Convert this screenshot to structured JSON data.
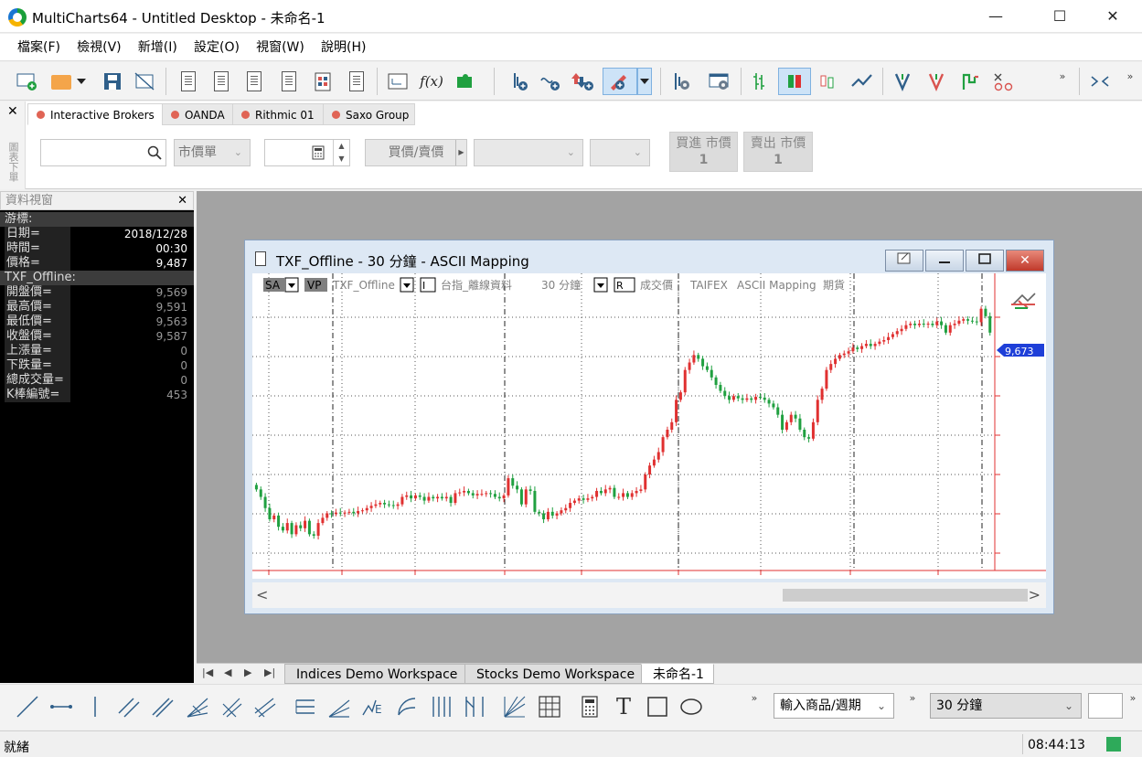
{
  "window": {
    "title": "MultiCharts64 - Untitled Desktop - 未命名-1",
    "minimize": "—",
    "maximize": "☐",
    "close": "✕"
  },
  "menu": [
    "檔案(F)",
    "檢視(V)",
    "新增(I)",
    "設定(O)",
    "視窗(W)",
    "說明(H)"
  ],
  "toolbar_icons": [
    "new-desktop-icon",
    "open-workspace-icon",
    "save-icon",
    "close-workspace-icon",
    "new-chart-icon",
    "new-scanner-icon",
    "new-dom-icon",
    "new-portfolio-icon",
    "new-spreadsheet-icon",
    "new-window-icon",
    "power-language-editor-icon",
    "add-component-icon",
    "insert-indicator-icon",
    "insert-signal-icon",
    "order-entry-icon",
    "draw-tool-icon",
    "format-icon",
    "chart-settings-icon",
    "ohlc-bar-icon",
    "candlestick-icon",
    "hollow-candle-icon",
    "line-chart-icon",
    "dot-icon",
    "v-icon",
    "step-icon",
    "x-o-icon",
    "collapse-icon"
  ],
  "order_panel": {
    "close": "✕",
    "side_label": "圖表下單",
    "brokers": [
      {
        "name": "Interactive Brokers",
        "active": true
      },
      {
        "name": "OANDA",
        "active": false
      },
      {
        "name": "Rithmic 01",
        "active": false
      },
      {
        "name": "Saxo Group",
        "active": false
      }
    ],
    "symbol_placeholder": "",
    "order_type": "市價單",
    "quantity": "",
    "buy_sell": "買價/賣價",
    "buy_button": {
      "label": "買進 市價",
      "qty": "1"
    },
    "sell_button": {
      "label": "賣出 市價",
      "qty": "1"
    }
  },
  "data_window": {
    "title": "資料視窗",
    "close": "✕",
    "cursor_section": "游標:",
    "cursor_rows": [
      {
        "label": "日期=",
        "value": "2018/12/28"
      },
      {
        "label": "時間=",
        "value": "00:30"
      },
      {
        "label": "價格=",
        "value": "9,487"
      }
    ],
    "symbol_section": "TXF_Offline:",
    "symbol_rows": [
      {
        "label": "開盤價=",
        "value": "9,569"
      },
      {
        "label": "最高價=",
        "value": "9,591"
      },
      {
        "label": "最低價=",
        "value": "9,563"
      },
      {
        "label": "收盤價=",
        "value": "9,587"
      },
      {
        "label": "上漲量=",
        "value": "0"
      },
      {
        "label": "下跌量=",
        "value": "0"
      },
      {
        "label": "總成交量=",
        "value": "0"
      },
      {
        "label": "K棒編號=",
        "value": "453"
      }
    ]
  },
  "chart_window": {
    "title": "TXF_Offline - 30 分鐘 - ASCII Mapping",
    "header": {
      "sa": "SA",
      "vp": "VP",
      "symbol": "TXF_Offline",
      "i_toggle": "I",
      "description": "台指_離線資料",
      "interval": "30 分鐘",
      "r_toggle": "R",
      "field": "成交價",
      "exchange": "TAIFEX",
      "data_source": "ASCII Mapping",
      "category": "期貨"
    },
    "last_price": "9,673",
    "scroll_left": "<",
    "scroll_right": ">"
  },
  "chart_data": {
    "type": "candlestick",
    "title": "TXF_Offline - 30 分鐘 - ASCII Mapping",
    "last_price": 9673,
    "up_color": "#e03030",
    "down_color": "#20a040",
    "closes": [
      9480,
      9470,
      9455,
      9440,
      9445,
      9430,
      9425,
      9435,
      9420,
      9432,
      9428,
      9438,
      9420,
      9418,
      9435,
      9442,
      9448,
      9447,
      9449,
      9448,
      9449,
      9450,
      9448,
      9451,
      9452,
      9455,
      9458,
      9460,
      9462,
      9460,
      9459,
      9458,
      9460,
      9470,
      9472,
      9468,
      9472,
      9470,
      9465,
      9470,
      9468,
      9470,
      9468,
      9470,
      9462,
      9475,
      9476,
      9478,
      9475,
      9472,
      9474,
      9474,
      9475,
      9474,
      9470,
      9468,
      9472,
      9495,
      9485,
      9480,
      9460,
      9480,
      9478,
      9450,
      9448,
      9440,
      9450,
      9445,
      9448,
      9452,
      9455,
      9462,
      9465,
      9468,
      9466,
      9468,
      9470,
      9478,
      9475,
      9480,
      9482,
      9470,
      9470,
      9475,
      9470,
      9475,
      9478,
      9480,
      9500,
      9512,
      9520,
      9530,
      9550,
      9560,
      9570,
      9600,
      9610,
      9640,
      9650,
      9660,
      9655,
      9645,
      9640,
      9630,
      9620,
      9612,
      9605,
      9600,
      9605,
      9602,
      9600,
      9602,
      9600,
      9604,
      9603,
      9600,
      9595,
      9590,
      9580,
      9560,
      9570,
      9580,
      9575,
      9560,
      9550,
      9548,
      9570,
      9600,
      9615,
      9640,
      9648,
      9655,
      9660,
      9662,
      9665,
      9670,
      9668,
      9672,
      9675,
      9672,
      9675,
      9678,
      9680,
      9684,
      9688,
      9692,
      9695,
      9700,
      9702,
      9700,
      9702,
      9701,
      9702,
      9700,
      9705,
      9700,
      9690,
      9700,
      9702,
      9706,
      9708,
      9706,
      9705,
      9704,
      9722,
      9712,
      9690
    ]
  },
  "workspace_tabs": {
    "nav": [
      "|◀",
      "◀",
      "▶",
      "▶|"
    ],
    "tabs": [
      {
        "label": "Indices Demo Workspace",
        "active": false
      },
      {
        "label": "Stocks Demo Workspace",
        "active": false
      },
      {
        "label": "未命名-1",
        "active": true
      }
    ]
  },
  "drawing_tools": [
    "trend-line-icon",
    "horizontal-line-icon",
    "vertical-line-icon",
    "parallel-channel-icon",
    "regression-channel-icon",
    "fib-fan-icon",
    "andrews-pitchfork-icon",
    "gann-fan-icon",
    "fib-retracement-icon",
    "speed-lines-icon",
    "elliott-wave-icon",
    "arc-icon",
    "time-zones-icon",
    "fib-time-icon",
    "gann-angles-icon",
    "grid-icon",
    "calculator-icon",
    "text-icon",
    "rectangle-icon",
    "ellipse-icon"
  ],
  "symbol_input": "輸入商品/週期",
  "interval_select": "30 分鐘",
  "status": {
    "text": "就緒",
    "time": "08:44:13",
    "connection_color": "#2eaa5a"
  }
}
